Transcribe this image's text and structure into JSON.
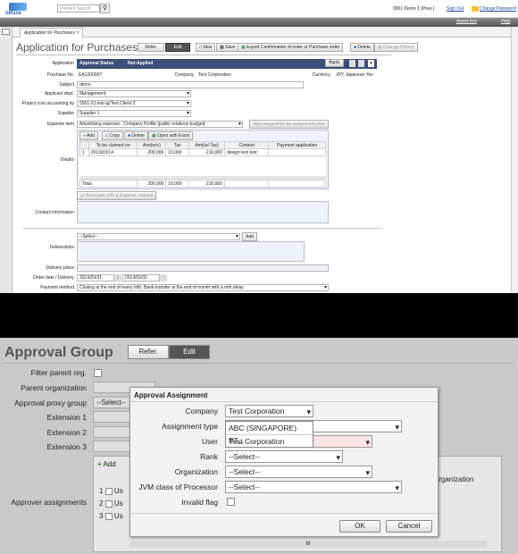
{
  "header": {
    "logo": "bBase",
    "search_placeholder": "Phone# Search",
    "user": "0001 Demo 1 (Pres.)",
    "signout": "Sign Out",
    "change_password": "Change Password",
    "assist": "Assist tool",
    "help": "Help"
  },
  "tab": {
    "label": "Application for Purchases",
    "close": "×"
  },
  "page": {
    "title": "Application for Purchases",
    "refer": "Refer.",
    "edit": "Edit",
    "new": "New",
    "save": "Save",
    "export": "Export Confirmation of order or Purchase order",
    "delete": "Delete",
    "change_history": "Change History"
  },
  "form": {
    "application_label": "Application",
    "approval_status": "Approval Status",
    "approval_value": "Not-Applied",
    "apply": "Apply",
    "purchase_no_label": "Purchase No.",
    "purchase_no": "EA1200007",
    "company_label": "Company",
    "company": "Test Corporation",
    "currency_label": "Currency",
    "currency": "JPY Japanese Yen",
    "subject_label": "Subject",
    "subject": "demo",
    "dept_label": "Applicant dept.",
    "dept": "Management",
    "project_label": "Project cost accounting by",
    "project": "5501-01:test-pj/Test Client 3",
    "supplier_label": "Supplier",
    "supplier": "Supplier 1",
    "expense_label": "Expense item",
    "expense": "Advertising expense : Company Profile [public relations budget]",
    "auto_suggestion": "Auto-suggestion by assignment plan",
    "details_label": "Details",
    "add": "Add",
    "copy": "Copy",
    "del": "Delete",
    "open_excel": "Open with Excel",
    "columns": [
      "",
      "To be claimed on",
      "Amt(w/o)",
      "Tax",
      "Amt(w/ Tax)",
      "Content",
      "Payment application"
    ],
    "row": [
      "1",
      "2013/03/14",
      "200,000",
      "10,000",
      "210,000",
      "design test test",
      ""
    ],
    "total": [
      "Total",
      "200,000",
      "10,000",
      "210,000"
    ],
    "associate": "Associate with a Expense request",
    "contact_label": "Contact information",
    "deliverables_label": "Deliverables",
    "deliverables_select": "--Select--",
    "deliverables_add": "Add",
    "delivery_place_label": "Delivery place",
    "order_label": "Order date / Delivery",
    "order_date": "2013/03/31",
    "delivery_date": "2013/03/31",
    "payment_label": "Payment method",
    "payment": "Closing at the end of every mth. Bank transfer at the end of month with a mth delay"
  },
  "approval": {
    "title": "Approval Group",
    "refer": "Refer.",
    "edit": "Edit",
    "filter_label": "Filter parent org.",
    "parent_label": "Parent organization",
    "proxy_label": "Approval proxy group",
    "proxy_value": "--Select--",
    "ext1": "Extension 1",
    "ext2": "Extension 2",
    "ext3": "Extension 3",
    "assignments_label": "Approver assignments",
    "add": "Add",
    "col_org": "Organization",
    "rows": [
      "1",
      "2",
      "3"
    ],
    "row_text": "Us",
    "scroll": "III"
  },
  "dialog": {
    "title": "Approval Assignment",
    "company_label": "Company",
    "company": "Test Corporation",
    "assign_type_label": "Assignment type",
    "assign_type": "ABC (SINGAPORE) PT...",
    "dropdown": [
      "ABC (SINGAPORE) PT...",
      "Test Corporation"
    ],
    "user_label": "User",
    "rank_label": "Rank",
    "rank": "--Select--",
    "org_label": "Organization",
    "org": "--Select--",
    "jvm_label": "JVM class of Processor",
    "jvm": "--Select--",
    "invalid_label": "Invalid flag",
    "ok": "OK",
    "cancel": "Cancel"
  }
}
